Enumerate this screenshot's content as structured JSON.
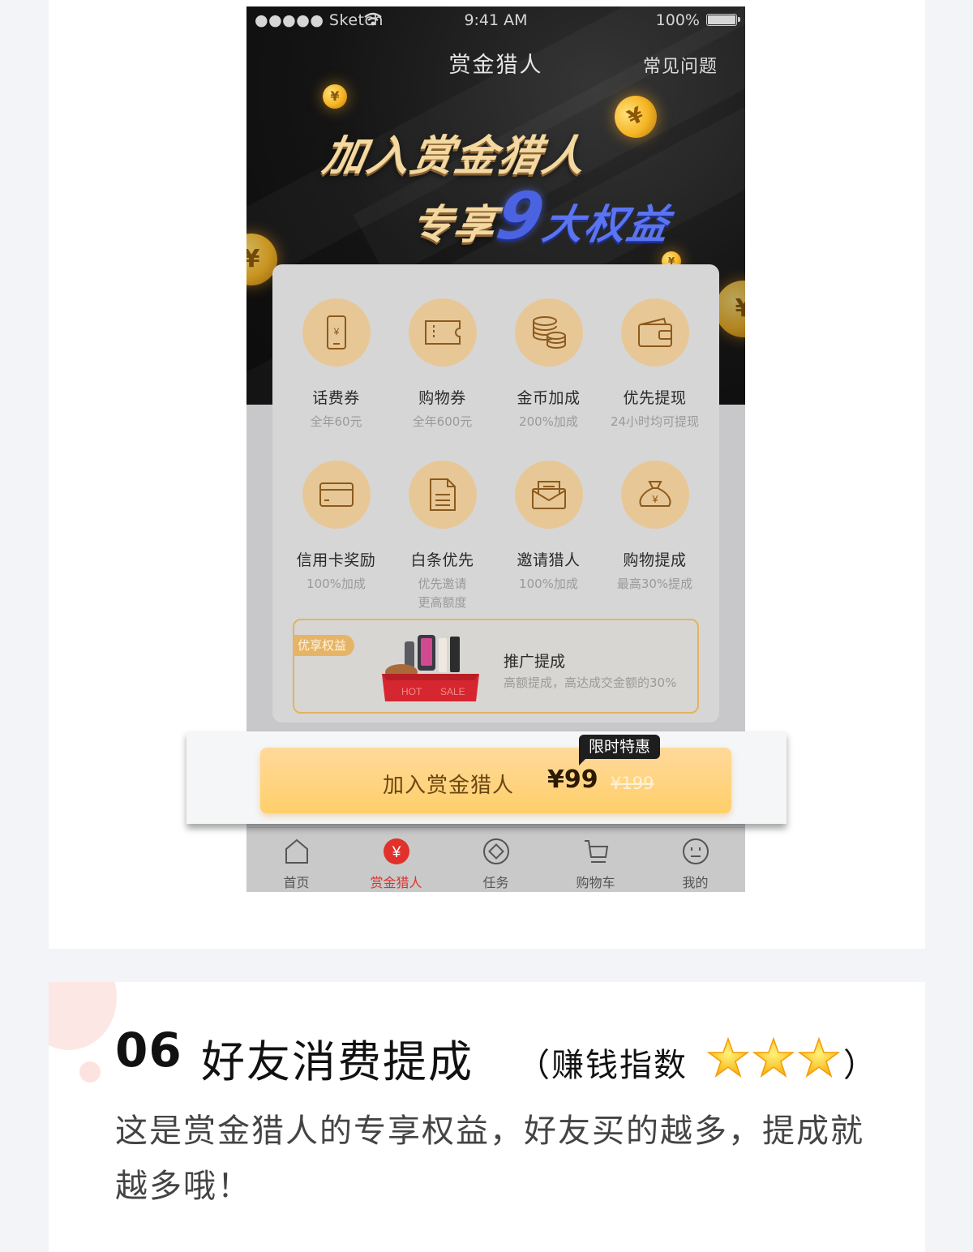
{
  "status_bar": {
    "carrier": "●●●●● Sketch",
    "time": "9:41 AM",
    "battery": "100%"
  },
  "nav": {
    "title": "赏金猎人",
    "faq": "常见问题"
  },
  "hero": {
    "line1": "加入赏金猎人",
    "line2_prefix": "专享",
    "line2_number": "9",
    "line2_suffix": "大权益"
  },
  "benefits": [
    {
      "icon": "phone-yuan-icon",
      "title": "话费券",
      "sub": "全年60元"
    },
    {
      "icon": "ticket-icon",
      "title": "购物券",
      "sub": "全年600元"
    },
    {
      "icon": "coins-stack-icon",
      "title": "金币加成",
      "sub": "200%加成"
    },
    {
      "icon": "wallet-icon",
      "title": "优先提现",
      "sub": "24小时均可提现"
    },
    {
      "icon": "credit-card-icon",
      "title": "信用卡奖励",
      "sub": "100%加成"
    },
    {
      "icon": "document-icon",
      "title": "白条优先",
      "sub": "优先邀请",
      "sub2": "更高额度"
    },
    {
      "icon": "envelope-icon",
      "title": "邀请猎人",
      "sub": "100%加成"
    },
    {
      "icon": "money-bag-icon",
      "title": "购物提成",
      "sub": "最高30%提成"
    }
  ],
  "promo": {
    "tag": "优享权益",
    "title": "推广提成",
    "sub": "高额提成，高达成交金额的30%",
    "box_text_1": "HOT",
    "box_text_2": "SALE"
  },
  "cta": {
    "label": "加入赏金猎人",
    "price": "¥99",
    "old_price": "¥199",
    "badge": "限时特惠"
  },
  "tabbar": [
    {
      "icon": "home-icon",
      "label": "首页",
      "active": false
    },
    {
      "icon": "bounty-yuan-icon",
      "label": "赏金猎人",
      "active": true
    },
    {
      "icon": "task-diamond-icon",
      "label": "任务",
      "active": false
    },
    {
      "icon": "cart-icon",
      "label": "购物车",
      "active": false
    },
    {
      "icon": "smiley-icon",
      "label": "我的",
      "active": false
    }
  ],
  "section": {
    "number": "06",
    "title": "好友消费提成",
    "rating_label": "（赚钱指数",
    "rating_close": "）",
    "stars": 3,
    "description": "这是赏金猎人的专享权益，好友买的越多，提成就越多哦！"
  },
  "colors": {
    "accent_gold": "#e8c796",
    "active_red": "#e0312b",
    "cta": "#ffcf6a"
  }
}
